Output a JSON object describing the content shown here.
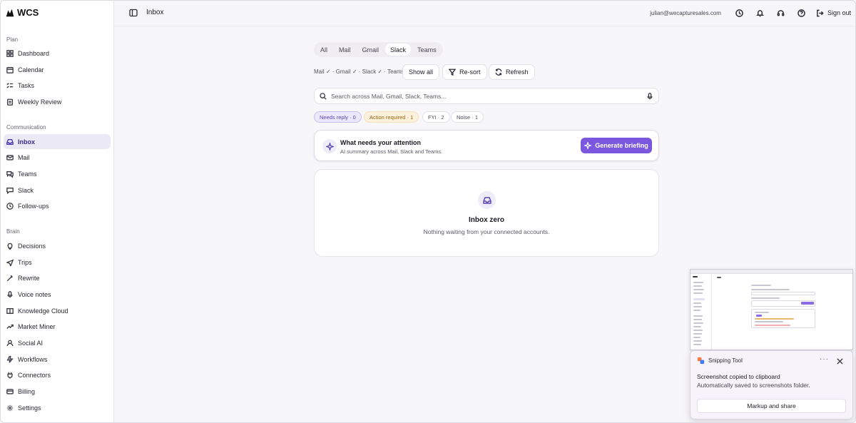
{
  "brand": {
    "name": "WCS"
  },
  "sidebar": {
    "sections": [
      {
        "label": "Plan",
        "items": [
          {
            "label": "Dashboard",
            "icon": "dashboard-icon"
          },
          {
            "label": "Calendar",
            "icon": "calendar-icon"
          },
          {
            "label": "Tasks",
            "icon": "tasks-icon"
          },
          {
            "label": "Weekly Review",
            "icon": "clipboard-icon"
          }
        ]
      },
      {
        "label": "Communication",
        "items": [
          {
            "label": "Inbox",
            "icon": "inbox-icon",
            "active": true
          },
          {
            "label": "Mail",
            "icon": "mail-icon"
          },
          {
            "label": "Teams",
            "icon": "chat-icon"
          },
          {
            "label": "Slack",
            "icon": "slack-icon"
          },
          {
            "label": "Follow-ups",
            "icon": "clock-icon"
          }
        ]
      },
      {
        "label": "Brain",
        "items": [
          {
            "label": "Decisions",
            "icon": "lightbulb-icon"
          },
          {
            "label": "Trips",
            "icon": "plane-icon"
          },
          {
            "label": "Rewrite",
            "icon": "wand-icon"
          },
          {
            "label": "Voice notes",
            "icon": "microphone-icon"
          },
          {
            "label": "Knowledge Cloud",
            "icon": "book-icon"
          },
          {
            "label": "Market Miner",
            "icon": "trend-icon"
          },
          {
            "label": "Social AI",
            "icon": "user-icon"
          },
          {
            "label": "Workflows",
            "icon": "workflow-icon"
          },
          {
            "label": "Connectors",
            "icon": "plug-icon"
          },
          {
            "label": "Billing",
            "icon": "card-icon"
          },
          {
            "label": "Settings",
            "icon": "gear-icon"
          }
        ]
      }
    ]
  },
  "header": {
    "title": "Inbox",
    "email": "julian@wecapturesales.com",
    "sign_out": "Sign out"
  },
  "main": {
    "tabs": [
      {
        "label": "All"
      },
      {
        "label": "Mail"
      },
      {
        "label": "Gmail"
      },
      {
        "label": "Slack",
        "active": true
      },
      {
        "label": "Teams"
      }
    ],
    "source_filters": "Mail ✓ · Gmail ✓ · Slack ✓ · Teams ✓",
    "show_all": "Show all",
    "resort": "Re-sort",
    "refresh": "Refresh",
    "search_placeholder": "Search across Mail, Gmail, Slack, Teams...",
    "chips": {
      "needs_reply": "Needs reply · 0",
      "action_required": "Action required · 1",
      "fyi": "FYI · 2",
      "noise": "Noise · 1"
    },
    "attention": {
      "title": "What needs your attention",
      "subtitle": "AI summary across Mail, Slack and Teams.",
      "button": "Generate briefing"
    },
    "empty": {
      "title": "Inbox zero",
      "subtitle": "Nothing waiting from your connected accounts."
    }
  },
  "snipping": {
    "app": "Snipping Tool",
    "more": "···",
    "title": "Screenshot copied to clipboard",
    "subtitle": "Automatically saved to screenshots folder.",
    "button": "Markup and share"
  },
  "colors": {
    "accent": "#7b57e0",
    "active_bg": "#ece9f7",
    "amber_chip": "#fdf1dc",
    "purple_chip": "#ece8fb"
  }
}
